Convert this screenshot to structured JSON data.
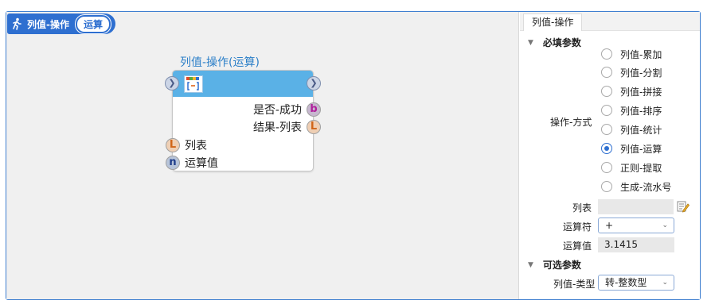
{
  "canvas": {
    "tab": {
      "title": "列值-操作",
      "chip": "运算",
      "icon": "run-icon"
    },
    "node": {
      "title": "列值-操作(运算)",
      "icon": "list-op-icon",
      "outputs": [
        {
          "label": "是否-成功",
          "port": "b",
          "color": "#b01f9b"
        },
        {
          "label": "结果-列表",
          "port": "L",
          "color": "#d06417"
        }
      ],
      "inputs": [
        {
          "label": "列表",
          "port": "L",
          "color": "#d06417"
        },
        {
          "label": "运算值",
          "port": "n",
          "color": "#1e3c8a"
        }
      ]
    }
  },
  "panel": {
    "tab": "列值-操作",
    "required_section": "必填参数",
    "operation_label": "操作-方式",
    "operations": [
      "列值-累加",
      "列值-分割",
      "列值-拼接",
      "列值-排序",
      "列值-统计",
      "列值-运算",
      "正则-提取",
      "生成-流水号"
    ],
    "selected_operation": "列值-运算",
    "list_label": "列表",
    "list_value": "",
    "operator_label": "运算符",
    "operator_value": "+",
    "operand_label": "运算值",
    "operand_value": "3.1415",
    "optional_section": "可选参数",
    "type_label": "列值-类型",
    "type_value": "转-整数型"
  },
  "colors": {
    "accent": "#2e6fd0",
    "node_header": "#5ab1e6",
    "frame": "#3f7fd0"
  }
}
